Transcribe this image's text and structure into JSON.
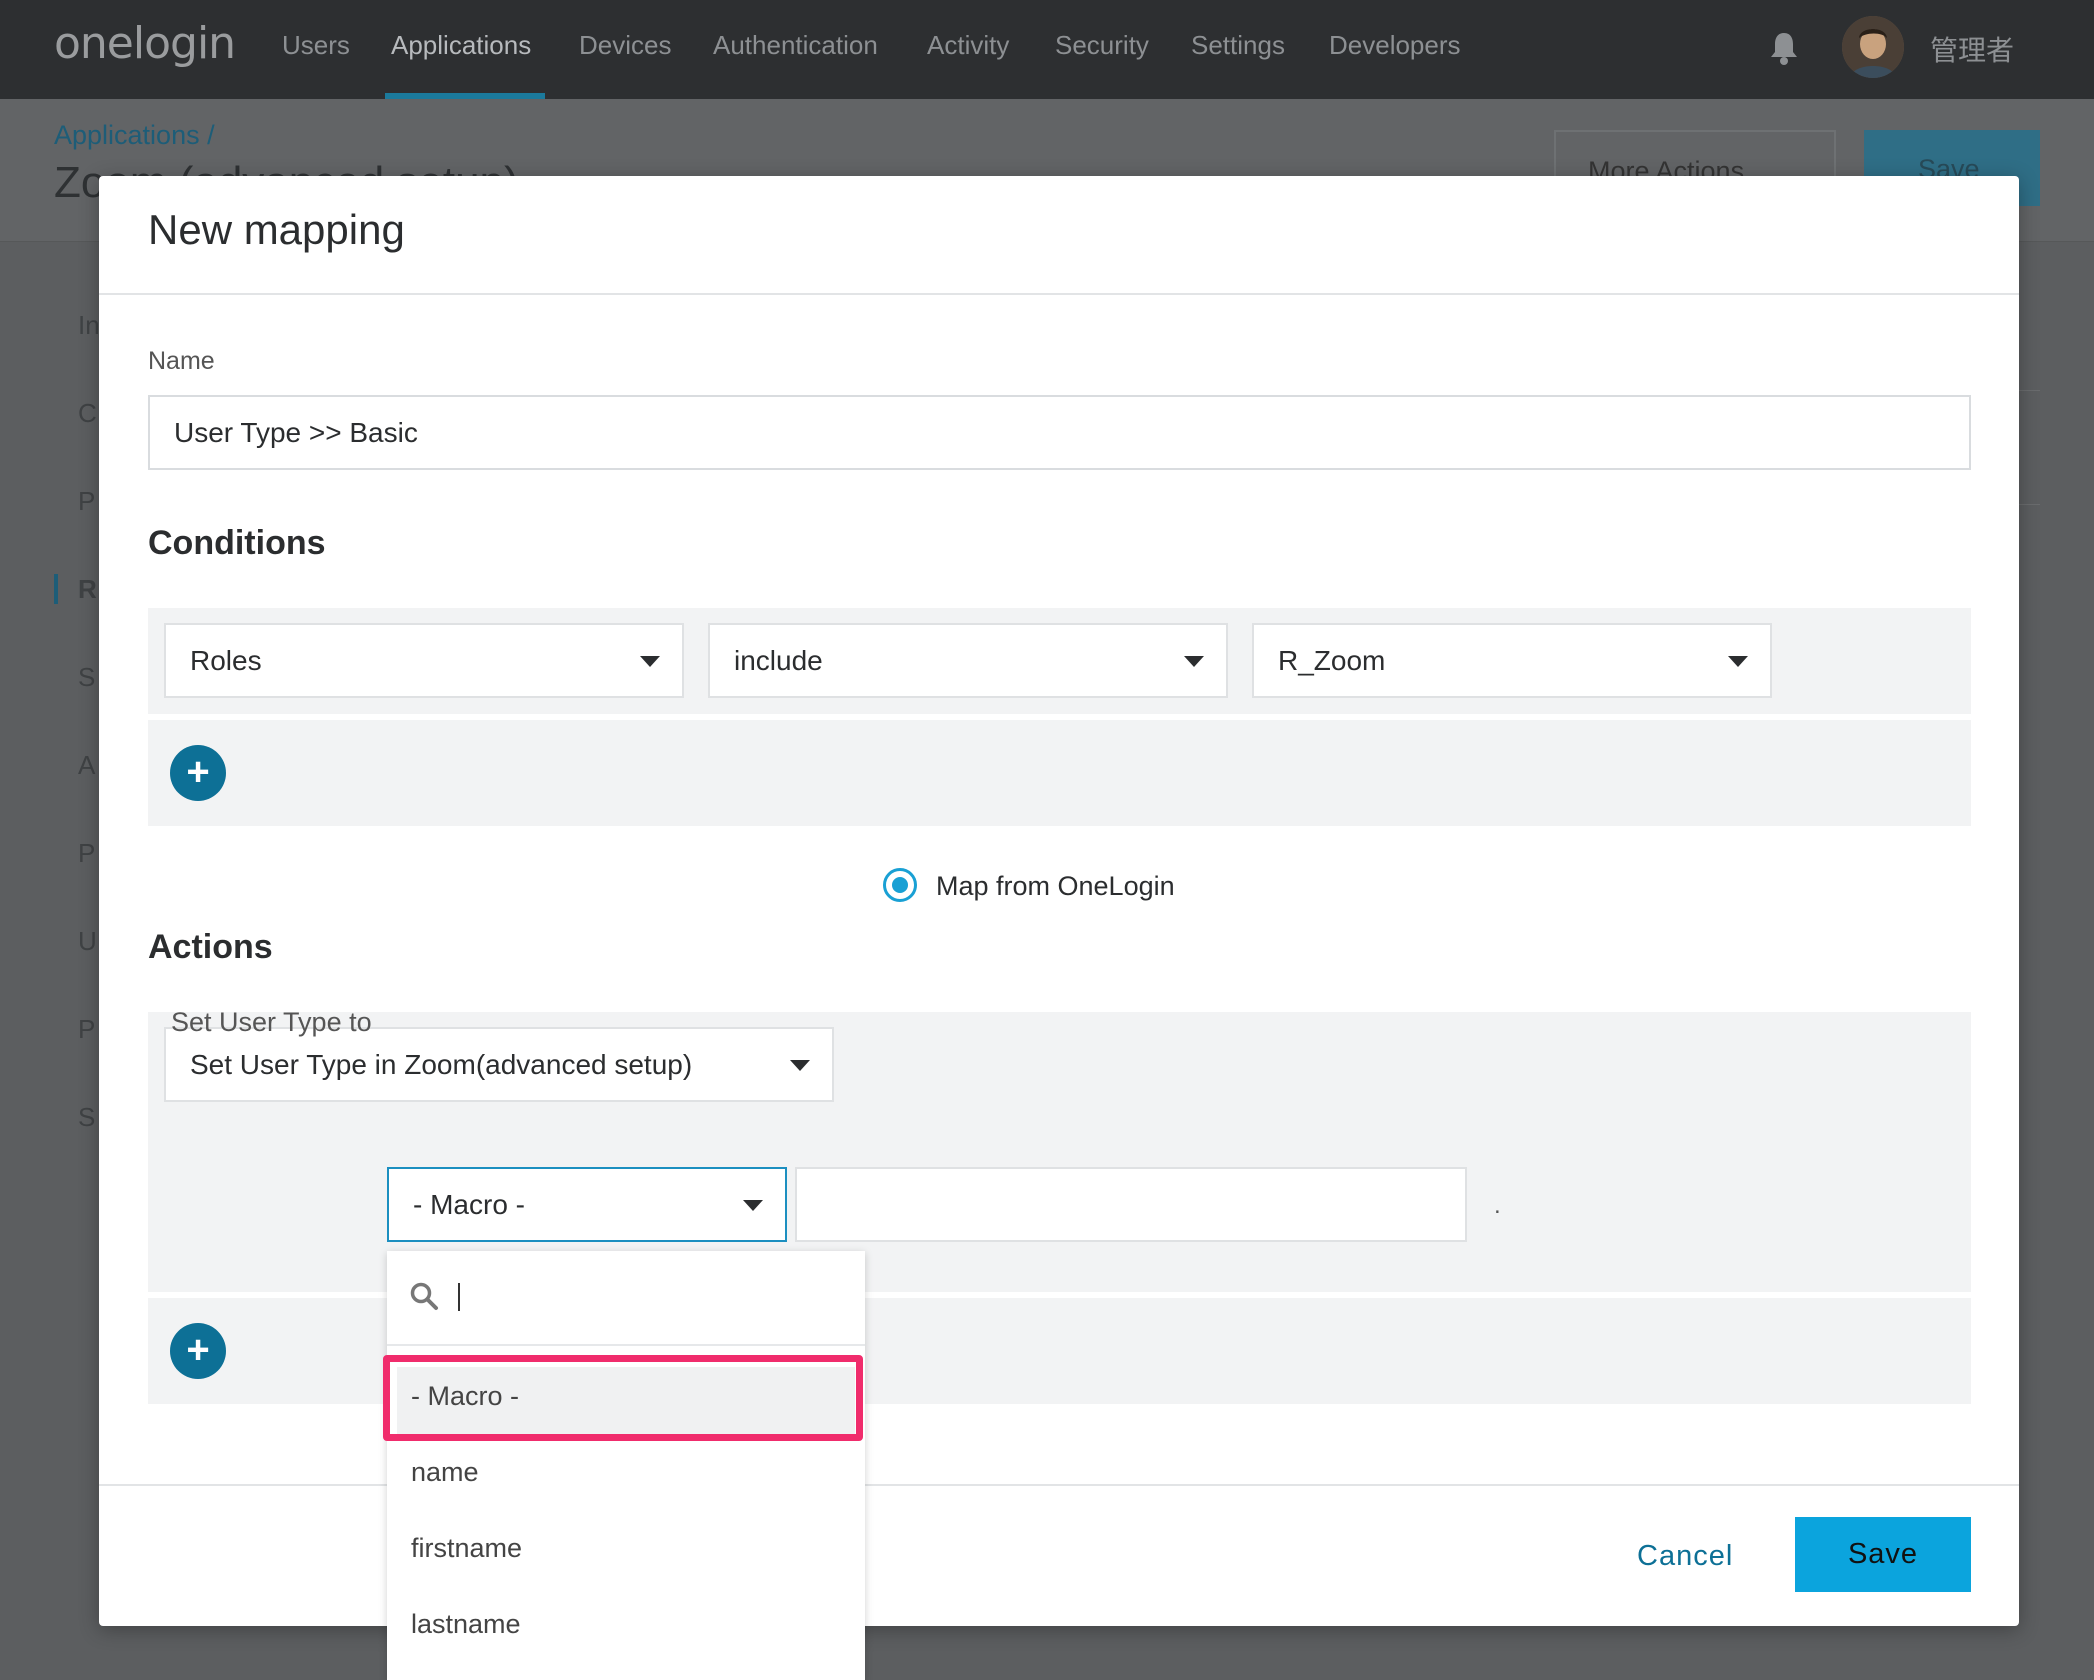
{
  "nav": {
    "logo": "onelogin",
    "items": [
      "Users",
      "Applications",
      "Devices",
      "Authentication",
      "Activity",
      "Security",
      "Settings",
      "Developers"
    ],
    "active": "Applications",
    "user_name": "管理者"
  },
  "background": {
    "breadcrumb": "Applications /",
    "page_title": "Zoom (advanced setup)",
    "more_actions": "More Actions",
    "save": "Save",
    "sidebar_initials": [
      "In",
      "C",
      "P",
      "R",
      "S",
      "A",
      "P",
      "U",
      "P",
      "S"
    ]
  },
  "modal": {
    "title": "New mapping",
    "name_label": "Name",
    "name_value": "User Type >> Basic",
    "conditions_title": "Conditions",
    "condition": {
      "field": "Roles",
      "operator": "include",
      "value": "R_Zoom"
    },
    "actions_title": "Actions",
    "action": {
      "select": "Set User Type in Zoom(advanced setup)",
      "radio_label": "Map from OneLogin",
      "set_label": "Set User Type to",
      "macro_select": "- Macro -",
      "trailing_dot": "."
    },
    "add_symbol": "+",
    "cancel": "Cancel",
    "save": "Save"
  },
  "dropdown": {
    "search_value": "",
    "options": [
      "- Macro -",
      "name",
      "firstname",
      "lastname"
    ],
    "selected": "- Macro -"
  },
  "colors": {
    "accent": "#0ba4dd",
    "add_button": "#0d7096",
    "highlight": "#f02c6c",
    "nav_bg": "#2d2f31"
  }
}
